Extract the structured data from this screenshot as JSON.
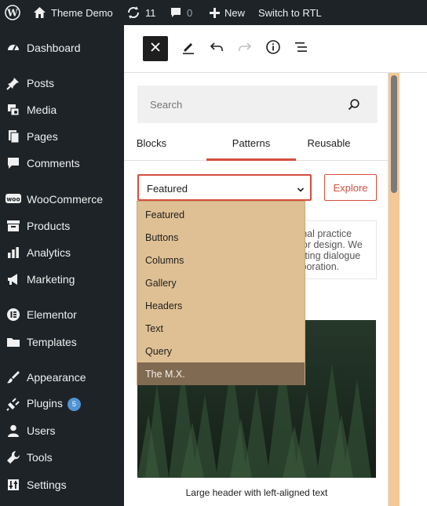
{
  "adminbar": {
    "site_name": "Theme Demo",
    "updates_count": "11",
    "comments_count": "0",
    "new_label": "New",
    "rtl_label": "Switch to RTL"
  },
  "sidebar": {
    "items": [
      {
        "label": "Dashboard",
        "icon": "dashboard-icon"
      },
      {
        "label": "Posts",
        "icon": "pin-icon"
      },
      {
        "label": "Media",
        "icon": "media-icon"
      },
      {
        "label": "Pages",
        "icon": "pages-icon"
      },
      {
        "label": "Comments",
        "icon": "comment-icon"
      },
      {
        "label": "WooCommerce",
        "icon": "woo-icon"
      },
      {
        "label": "Products",
        "icon": "archive-icon"
      },
      {
        "label": "Analytics",
        "icon": "bar-chart-icon"
      },
      {
        "label": "Marketing",
        "icon": "megaphone-icon"
      },
      {
        "label": "Elementor",
        "icon": "elementor-icon"
      },
      {
        "label": "Templates",
        "icon": "folder-icon"
      },
      {
        "label": "Appearance",
        "icon": "brush-icon"
      },
      {
        "label": "Plugins",
        "icon": "plug-icon",
        "badge": "5"
      },
      {
        "label": "Users",
        "icon": "user-icon"
      },
      {
        "label": "Tools",
        "icon": "wrench-icon"
      },
      {
        "label": "Settings",
        "icon": "settings-icon"
      }
    ]
  },
  "inserter": {
    "search_placeholder": "Search",
    "tabs": [
      "Blocks",
      "Patterns",
      "Reusable"
    ],
    "active_tab": "Patterns",
    "category_value": "Featured",
    "explore_label": "Explore",
    "categories": [
      "Featured",
      "Buttons",
      "Columns",
      "Gallery",
      "Headers",
      "Text",
      "Query",
      "The M.X."
    ],
    "selected_category": "The M.X.",
    "pattern_text_lines": [
      "tional practice",
      "erior design. We",
      "moting dialogue",
      "llaboration."
    ],
    "pattern_caption": "Large header with left-aligned text"
  },
  "colors": {
    "accent": "#d54e3f",
    "admin_dark": "#1d2327",
    "dropdown_bg": "#dfc094",
    "dropdown_selected": "#806a51"
  }
}
